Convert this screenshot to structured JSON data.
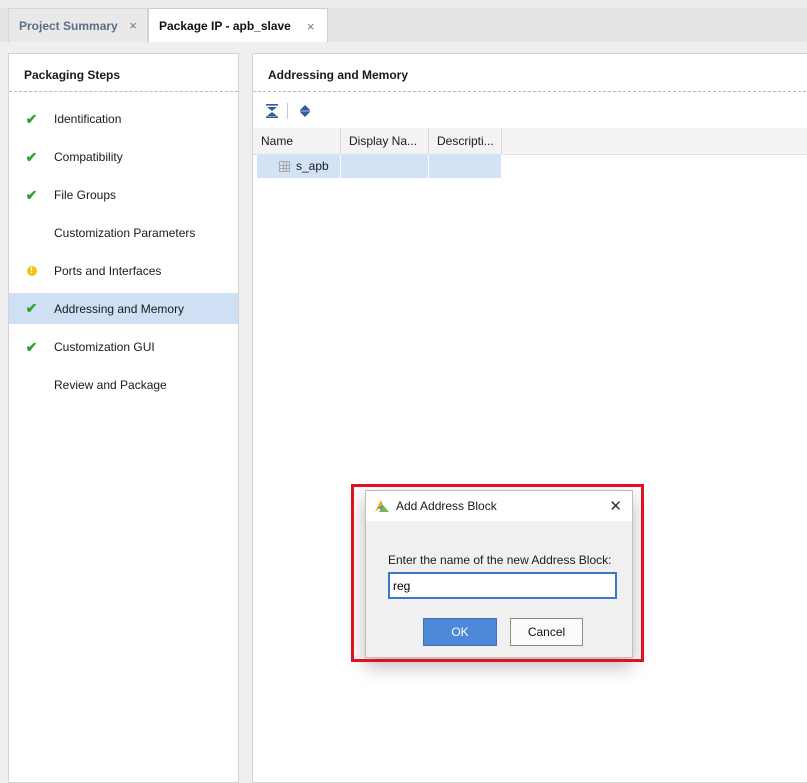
{
  "tabs": [
    {
      "label": "Project Summary",
      "close": "×",
      "active": false
    },
    {
      "label": "Package IP - apb_slave",
      "close": "×",
      "active": true
    }
  ],
  "left_panel": {
    "title": "Packaging Steps",
    "steps": [
      {
        "label": "Identification",
        "status": "check",
        "icon": "check-icon"
      },
      {
        "label": "Compatibility",
        "status": "check",
        "icon": "check-icon"
      },
      {
        "label": "File Groups",
        "status": "check",
        "icon": "check-icon"
      },
      {
        "label": "Customization Parameters",
        "status": "none",
        "icon": ""
      },
      {
        "label": "Ports and Interfaces",
        "status": "warning",
        "icon": "warning-icon"
      },
      {
        "label": "Addressing and Memory",
        "status": "check",
        "icon": "check-icon",
        "selected": true
      },
      {
        "label": "Customization GUI",
        "status": "check",
        "icon": "check-icon"
      },
      {
        "label": "Review and Package",
        "status": "none",
        "icon": ""
      }
    ]
  },
  "right_panel": {
    "title": "Addressing and Memory",
    "toolbar": {
      "collapse_icon": "collapse-all-icon",
      "expand_icon": "expand-all-icon"
    },
    "table": {
      "columns": [
        "Name",
        "Display Na...",
        "Descripti..."
      ],
      "rows": [
        {
          "name": "s_apb",
          "display_name": "",
          "description": "",
          "icon": "grid-icon"
        }
      ]
    }
  },
  "dialog": {
    "title": "Add Address Block",
    "close": "✕",
    "prompt": "Enter the name of the new Address Block:",
    "input_value": "reg",
    "ok_label": "OK",
    "cancel_label": "Cancel",
    "highlight_color": "#e0121e"
  }
}
